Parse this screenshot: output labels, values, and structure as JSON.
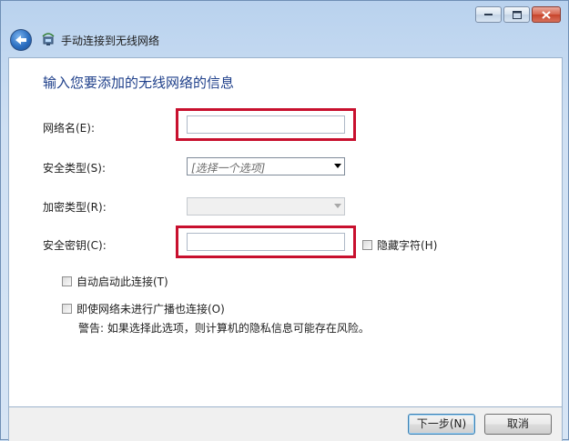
{
  "window": {
    "title": "手动连接到无线网络",
    "controls": {
      "minimize": "minimize",
      "maximize": "maximize",
      "close": "close"
    }
  },
  "heading": "输入您要添加的无线网络的信息",
  "form": {
    "network_name_label": "网络名(E):",
    "network_name_value": "",
    "security_type_label": "安全类型(S):",
    "security_type_value": "[选择一个选项]",
    "encryption_type_label": "加密类型(R):",
    "encryption_type_value": "",
    "security_key_label": "安全密钥(C):",
    "security_key_value": "",
    "hide_chars_label": "隐藏字符(H)"
  },
  "options": {
    "auto_start_label": "自动启动此连接(T)",
    "connect_even_if_not_broadcasting_label": "即使网络未进行广播也连接(O)",
    "warning_text": "警告: 如果选择此选项，则计算机的隐私信息可能存在风险。"
  },
  "buttons": {
    "next_label": "下一步(N)",
    "cancel_label": "取消"
  },
  "colors": {
    "highlight": "#c8102e",
    "heading": "#1e3f8a"
  },
  "icons": {
    "back": "back-arrow-icon",
    "wizard": "wireless-network-icon"
  }
}
